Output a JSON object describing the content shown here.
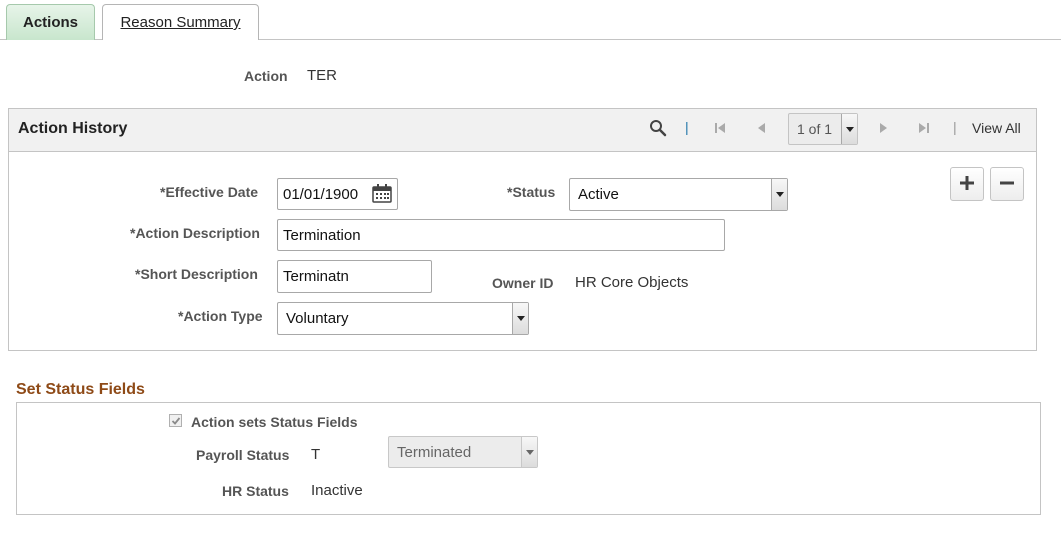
{
  "tabs": [
    {
      "label": "Actions",
      "active": true
    },
    {
      "label": "Reason Summary",
      "active": false
    }
  ],
  "action": {
    "label": "Action",
    "value": "TER"
  },
  "history": {
    "title": "Action History",
    "pager": {
      "current": "1 of 1",
      "view_all": "View All"
    },
    "effective_date": {
      "label": "*Effective Date",
      "value": "01/01/1900"
    },
    "status": {
      "label": "*Status",
      "value": "Active"
    },
    "action_description": {
      "label": "*Action Description",
      "value": "Termination"
    },
    "short_description": {
      "label": "*Short Description",
      "value": "Terminatn"
    },
    "owner": {
      "label": "Owner ID",
      "value": "HR Core Objects"
    },
    "action_type": {
      "label": "*Action Type",
      "value": "Voluntary"
    },
    "add_icon": "plus-icon",
    "delete_icon": "minus-icon"
  },
  "status_fields": {
    "title": "Set Status Fields",
    "checkbox_label": "Action sets Status Fields",
    "checkbox_checked": true,
    "payroll": {
      "label": "Payroll Status",
      "code": "T",
      "value": "Terminated"
    },
    "hr": {
      "label": "HR Status",
      "value": "Inactive"
    }
  },
  "colors": {
    "tab_active": "#c8e6cd",
    "section_title": "#8e4a17",
    "header_bg": "#f1f1f1"
  }
}
